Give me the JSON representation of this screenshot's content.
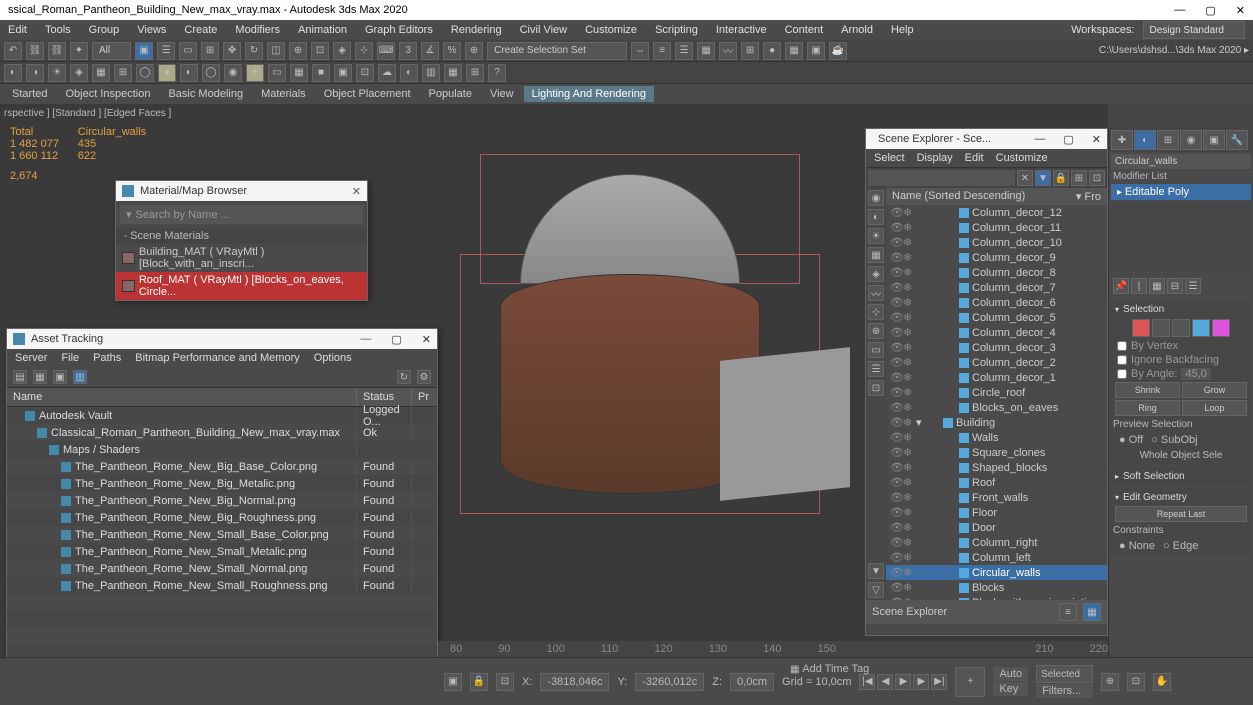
{
  "title": "ssical_Roman_Pantheon_Building_New_max_vray.max - Autodesk 3ds Max 2020",
  "menus": [
    "Edit",
    "Tools",
    "Group",
    "Views",
    "Create",
    "Modifiers",
    "Animation",
    "Graph Editors",
    "Rendering",
    "Civil View",
    "Customize",
    "Scripting",
    "Interactive",
    "Content",
    "Arnold",
    "Help"
  ],
  "workspace": {
    "label": "Workspaces:",
    "value": "Design Standard"
  },
  "path_display": "C:\\Users\\dshsd...\\3ds Max 2020 ▸",
  "selection_set": "Create Selection Set",
  "all_filter": "All",
  "tabs": [
    "Started",
    "Object Inspection",
    "Basic Modeling",
    "Materials",
    "Object Placement",
    "Populate",
    "View",
    "Lighting And Rendering"
  ],
  "active_tab": "Lighting And Rendering",
  "viewport": {
    "labels": "rspective ] [Standard ] [Edged Faces ]",
    "stats": {
      "total_label": "Total",
      "sel_label": "Circular_walls",
      "r1a": "1 482 077",
      "r1b": "435",
      "r2a": "1 660 112",
      "r2b": "622",
      "r3a": "2,674"
    }
  },
  "map_browser": {
    "title": "Material/Map Browser",
    "search": "Search by Name ...",
    "section": "Scene Materials",
    "items": [
      {
        "name": "Building_MAT  ( VRayMtl )  [Block_with_an_inscri..."
      },
      {
        "name": "Roof_MAT  ( VRayMtl )  [Blocks_on_eaves, Circle..."
      }
    ]
  },
  "asset": {
    "title": "Asset Tracking",
    "menus": [
      "Server",
      "File",
      "Paths",
      "Bitmap Performance and Memory",
      "Options"
    ],
    "cols": [
      "Name",
      "Status",
      "Pr"
    ],
    "rows": [
      {
        "name": "Autodesk Vault",
        "status": "Logged O...",
        "indent": 1,
        "icon": "vault"
      },
      {
        "name": "Classical_Roman_Pantheon_Building_New_max_vray.max",
        "status": "Ok",
        "indent": 2,
        "icon": "max"
      },
      {
        "name": "Maps / Shaders",
        "status": "",
        "indent": 3,
        "icon": "folder"
      },
      {
        "name": "The_Pantheon_Rome_New_Big_Base_Color.png",
        "status": "Found",
        "indent": 4,
        "icon": "img"
      },
      {
        "name": "The_Pantheon_Rome_New_Big_Metalic.png",
        "status": "Found",
        "indent": 4,
        "icon": "img"
      },
      {
        "name": "The_Pantheon_Rome_New_Big_Normal.png",
        "status": "Found",
        "indent": 4,
        "icon": "img"
      },
      {
        "name": "The_Pantheon_Rome_New_Big_Roughness.png",
        "status": "Found",
        "indent": 4,
        "icon": "img"
      },
      {
        "name": "The_Pantheon_Rome_New_Small_Base_Color.png",
        "status": "Found",
        "indent": 4,
        "icon": "img"
      },
      {
        "name": "The_Pantheon_Rome_New_Small_Metalic.png",
        "status": "Found",
        "indent": 4,
        "icon": "img"
      },
      {
        "name": "The_Pantheon_Rome_New_Small_Normal.png",
        "status": "Found",
        "indent": 4,
        "icon": "img"
      },
      {
        "name": "The_Pantheon_Rome_New_Small_Roughness.png",
        "status": "Found",
        "indent": 4,
        "icon": "img"
      }
    ]
  },
  "scene_explorer": {
    "title": "Scene Explorer - Sce...",
    "menus": [
      "Select",
      "Display",
      "Edit",
      "Customize"
    ],
    "header": "Name (Sorted Descending)",
    "header_r": "▾ Fro",
    "footer": "Scene Explorer",
    "items": [
      "Column_decor_12",
      "Column_decor_11",
      "Column_decor_10",
      "Column_decor_9",
      "Column_decor_8",
      "Column_decor_7",
      "Column_decor_6",
      "Column_decor_5",
      "Column_decor_4",
      "Column_decor_3",
      "Column_decor_2",
      "Column_decor_1",
      "Circle_roof",
      "Blocks_on_eaves",
      "Building",
      "Walls",
      "Square_clones",
      "Shaped_blocks",
      "Roof",
      "Front_walls",
      "Floor",
      "Door",
      "Column_right",
      "Column_left",
      "Circular_walls",
      "Blocks",
      "Block_with_an_inscription"
    ],
    "selected": "Circular_walls",
    "group": "Building"
  },
  "cmd": {
    "name": "Circular_walls",
    "modlist": "Modifier List",
    "modifier": "Editable Poly",
    "selection": "Selection",
    "by_vertex": "By Vertex",
    "ignore_backfacing": "Ignore Backfacing",
    "by_angle": "By Angle:",
    "angle_val": "45,0",
    "shrink": "Shrink",
    "grow": "Grow",
    "ring": "Ring",
    "loop": "Loop",
    "preview": "Preview Selection",
    "off": "Off",
    "subobj": "SubObj",
    "whole": "Whole Object Sele",
    "soft": "Soft Selection",
    "edit_geom": "Edit Geometry",
    "repeat": "Repeat Last",
    "constraints": "Constraints",
    "none": "None",
    "edge": "Edge"
  },
  "status": {
    "x": "X:",
    "xval": "-3818,046c",
    "y": "Y:",
    "yval": "-3260,012c",
    "z": "Z:",
    "zval": "0,0cm",
    "grid": "Grid = 10,0cm",
    "add_time": "Add Time Tag",
    "auto": "Auto",
    "key": "Key",
    "selected": "Selected",
    "filters": "Filters..."
  },
  "timeline": [
    "80",
    "90",
    "100",
    "110",
    "120",
    "130",
    "140",
    "150",
    "210",
    "220"
  ]
}
